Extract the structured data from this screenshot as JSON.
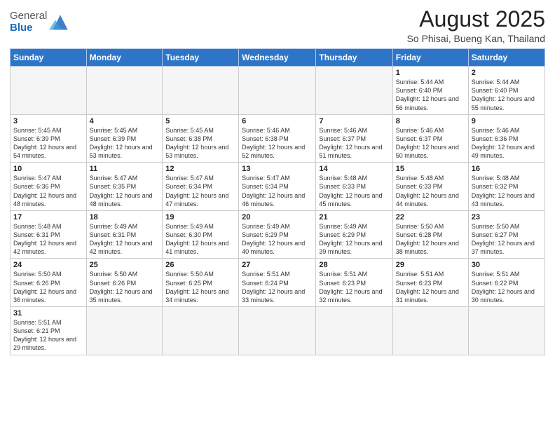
{
  "header": {
    "logo_general": "General",
    "logo_blue": "Blue",
    "month_title": "August 2025",
    "location": "So Phisai, Bueng Kan, Thailand"
  },
  "weekdays": [
    "Sunday",
    "Monday",
    "Tuesday",
    "Wednesday",
    "Thursday",
    "Friday",
    "Saturday"
  ],
  "weeks": [
    [
      {
        "day": "",
        "info": ""
      },
      {
        "day": "",
        "info": ""
      },
      {
        "day": "",
        "info": ""
      },
      {
        "day": "",
        "info": ""
      },
      {
        "day": "",
        "info": ""
      },
      {
        "day": "1",
        "info": "Sunrise: 5:44 AM\nSunset: 6:40 PM\nDaylight: 12 hours and 56 minutes."
      },
      {
        "day": "2",
        "info": "Sunrise: 5:44 AM\nSunset: 6:40 PM\nDaylight: 12 hours and 55 minutes."
      }
    ],
    [
      {
        "day": "3",
        "info": "Sunrise: 5:45 AM\nSunset: 6:39 PM\nDaylight: 12 hours and 54 minutes."
      },
      {
        "day": "4",
        "info": "Sunrise: 5:45 AM\nSunset: 6:39 PM\nDaylight: 12 hours and 53 minutes."
      },
      {
        "day": "5",
        "info": "Sunrise: 5:45 AM\nSunset: 6:38 PM\nDaylight: 12 hours and 53 minutes."
      },
      {
        "day": "6",
        "info": "Sunrise: 5:46 AM\nSunset: 6:38 PM\nDaylight: 12 hours and 52 minutes."
      },
      {
        "day": "7",
        "info": "Sunrise: 5:46 AM\nSunset: 6:37 PM\nDaylight: 12 hours and 51 minutes."
      },
      {
        "day": "8",
        "info": "Sunrise: 5:46 AM\nSunset: 6:37 PM\nDaylight: 12 hours and 50 minutes."
      },
      {
        "day": "9",
        "info": "Sunrise: 5:46 AM\nSunset: 6:36 PM\nDaylight: 12 hours and 49 minutes."
      }
    ],
    [
      {
        "day": "10",
        "info": "Sunrise: 5:47 AM\nSunset: 6:36 PM\nDaylight: 12 hours and 48 minutes."
      },
      {
        "day": "11",
        "info": "Sunrise: 5:47 AM\nSunset: 6:35 PM\nDaylight: 12 hours and 48 minutes."
      },
      {
        "day": "12",
        "info": "Sunrise: 5:47 AM\nSunset: 6:34 PM\nDaylight: 12 hours and 47 minutes."
      },
      {
        "day": "13",
        "info": "Sunrise: 5:47 AM\nSunset: 6:34 PM\nDaylight: 12 hours and 46 minutes."
      },
      {
        "day": "14",
        "info": "Sunrise: 5:48 AM\nSunset: 6:33 PM\nDaylight: 12 hours and 45 minutes."
      },
      {
        "day": "15",
        "info": "Sunrise: 5:48 AM\nSunset: 6:33 PM\nDaylight: 12 hours and 44 minutes."
      },
      {
        "day": "16",
        "info": "Sunrise: 5:48 AM\nSunset: 6:32 PM\nDaylight: 12 hours and 43 minutes."
      }
    ],
    [
      {
        "day": "17",
        "info": "Sunrise: 5:48 AM\nSunset: 6:31 PM\nDaylight: 12 hours and 42 minutes."
      },
      {
        "day": "18",
        "info": "Sunrise: 5:49 AM\nSunset: 6:31 PM\nDaylight: 12 hours and 42 minutes."
      },
      {
        "day": "19",
        "info": "Sunrise: 5:49 AM\nSunset: 6:30 PM\nDaylight: 12 hours and 41 minutes."
      },
      {
        "day": "20",
        "info": "Sunrise: 5:49 AM\nSunset: 6:29 PM\nDaylight: 12 hours and 40 minutes."
      },
      {
        "day": "21",
        "info": "Sunrise: 5:49 AM\nSunset: 6:29 PM\nDaylight: 12 hours and 39 minutes."
      },
      {
        "day": "22",
        "info": "Sunrise: 5:50 AM\nSunset: 6:28 PM\nDaylight: 12 hours and 38 minutes."
      },
      {
        "day": "23",
        "info": "Sunrise: 5:50 AM\nSunset: 6:27 PM\nDaylight: 12 hours and 37 minutes."
      }
    ],
    [
      {
        "day": "24",
        "info": "Sunrise: 5:50 AM\nSunset: 6:26 PM\nDaylight: 12 hours and 36 minutes."
      },
      {
        "day": "25",
        "info": "Sunrise: 5:50 AM\nSunset: 6:26 PM\nDaylight: 12 hours and 35 minutes."
      },
      {
        "day": "26",
        "info": "Sunrise: 5:50 AM\nSunset: 6:25 PM\nDaylight: 12 hours and 34 minutes."
      },
      {
        "day": "27",
        "info": "Sunrise: 5:51 AM\nSunset: 6:24 PM\nDaylight: 12 hours and 33 minutes."
      },
      {
        "day": "28",
        "info": "Sunrise: 5:51 AM\nSunset: 6:23 PM\nDaylight: 12 hours and 32 minutes."
      },
      {
        "day": "29",
        "info": "Sunrise: 5:51 AM\nSunset: 6:23 PM\nDaylight: 12 hours and 31 minutes."
      },
      {
        "day": "30",
        "info": "Sunrise: 5:51 AM\nSunset: 6:22 PM\nDaylight: 12 hours and 30 minutes."
      }
    ],
    [
      {
        "day": "31",
        "info": "Sunrise: 5:51 AM\nSunset: 6:21 PM\nDaylight: 12 hours and 29 minutes."
      },
      {
        "day": "",
        "info": ""
      },
      {
        "day": "",
        "info": ""
      },
      {
        "day": "",
        "info": ""
      },
      {
        "day": "",
        "info": ""
      },
      {
        "day": "",
        "info": ""
      },
      {
        "day": "",
        "info": ""
      }
    ]
  ]
}
